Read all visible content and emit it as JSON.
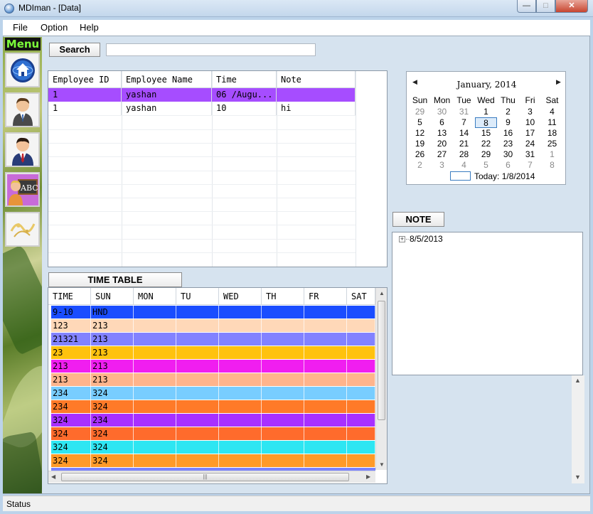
{
  "window": {
    "title": "MDIman - [Data]",
    "min_glyph": "—",
    "max_glyph": "□",
    "close_glyph": "✕"
  },
  "menubar": {
    "items": [
      "File",
      "Option",
      "Help"
    ]
  },
  "sidebar": {
    "label": "Menu",
    "buttons": [
      {
        "icon": "home-globe-icon"
      },
      {
        "icon": "employee-icon"
      },
      {
        "icon": "manager-icon"
      },
      {
        "icon": "teacher-abc-icon"
      },
      {
        "icon": "logo-icon"
      }
    ]
  },
  "search": {
    "button_label": "Search",
    "value": "",
    "placeholder": ""
  },
  "employee_grid": {
    "columns": [
      "Employee ID",
      "Employee Name",
      "Time",
      "Note"
    ],
    "rows": [
      {
        "id": "1",
        "name": "yashan",
        "time": "06 /Augu...",
        "note": "",
        "selected": true
      },
      {
        "id": "1",
        "name": "yashan",
        "time": "10",
        "note": "hi",
        "selected": false
      }
    ],
    "selected_color": "#a64dff"
  },
  "calendar": {
    "title": "January, 2014",
    "weekdays": [
      "Sun",
      "Mon",
      "Tue",
      "Wed",
      "Thu",
      "Fri",
      "Sat"
    ],
    "weeks": [
      [
        "29",
        "30",
        "31",
        "1",
        "2",
        "3",
        "4"
      ],
      [
        "5",
        "6",
        "7",
        "8",
        "9",
        "10",
        "11"
      ],
      [
        "12",
        "13",
        "14",
        "15",
        "16",
        "17",
        "18"
      ],
      [
        "19",
        "20",
        "21",
        "22",
        "23",
        "24",
        "25"
      ],
      [
        "26",
        "27",
        "28",
        "29",
        "30",
        "31",
        "1"
      ],
      [
        "2",
        "3",
        "4",
        "5",
        "6",
        "7",
        "8"
      ]
    ],
    "selected_day": "8",
    "today_label": "Today: 1/8/2014"
  },
  "note": {
    "button_label": "NOTE",
    "tree_items": [
      "8/5/2013"
    ],
    "expander": "+"
  },
  "timetable": {
    "button_label": "TIME TABLE",
    "columns": [
      "TIME",
      "SUN",
      "MON",
      "TU",
      "WED",
      "TH",
      "FR",
      "SAT"
    ],
    "rows": [
      {
        "time": "9-10",
        "sun": "HND",
        "color": "#1a4dff"
      },
      {
        "time": "123",
        "sun": "213",
        "color": "#ffd8b8"
      },
      {
        "time": "21321",
        "sun": "213",
        "color": "#8282ff"
      },
      {
        "time": "23",
        "sun": "213",
        "color": "#ffc20e"
      },
      {
        "time": "213",
        "sun": "213",
        "color": "#f01ef0"
      },
      {
        "time": "213",
        "sun": "213",
        "color": "#ffb48c"
      },
      {
        "time": "234",
        "sun": "324",
        "color": "#78cdff"
      },
      {
        "time": "234",
        "sun": "324",
        "color": "#ff7a28"
      },
      {
        "time": "324",
        "sun": "234",
        "color": "#a830ff"
      },
      {
        "time": "324",
        "sun": "324",
        "color": "#ff6b2c"
      },
      {
        "time": "324",
        "sun": "324",
        "color": "#2ee6f2"
      },
      {
        "time": "324",
        "sun": "324",
        "color": "#ff9a28"
      }
    ]
  },
  "status": {
    "text": "Status"
  }
}
